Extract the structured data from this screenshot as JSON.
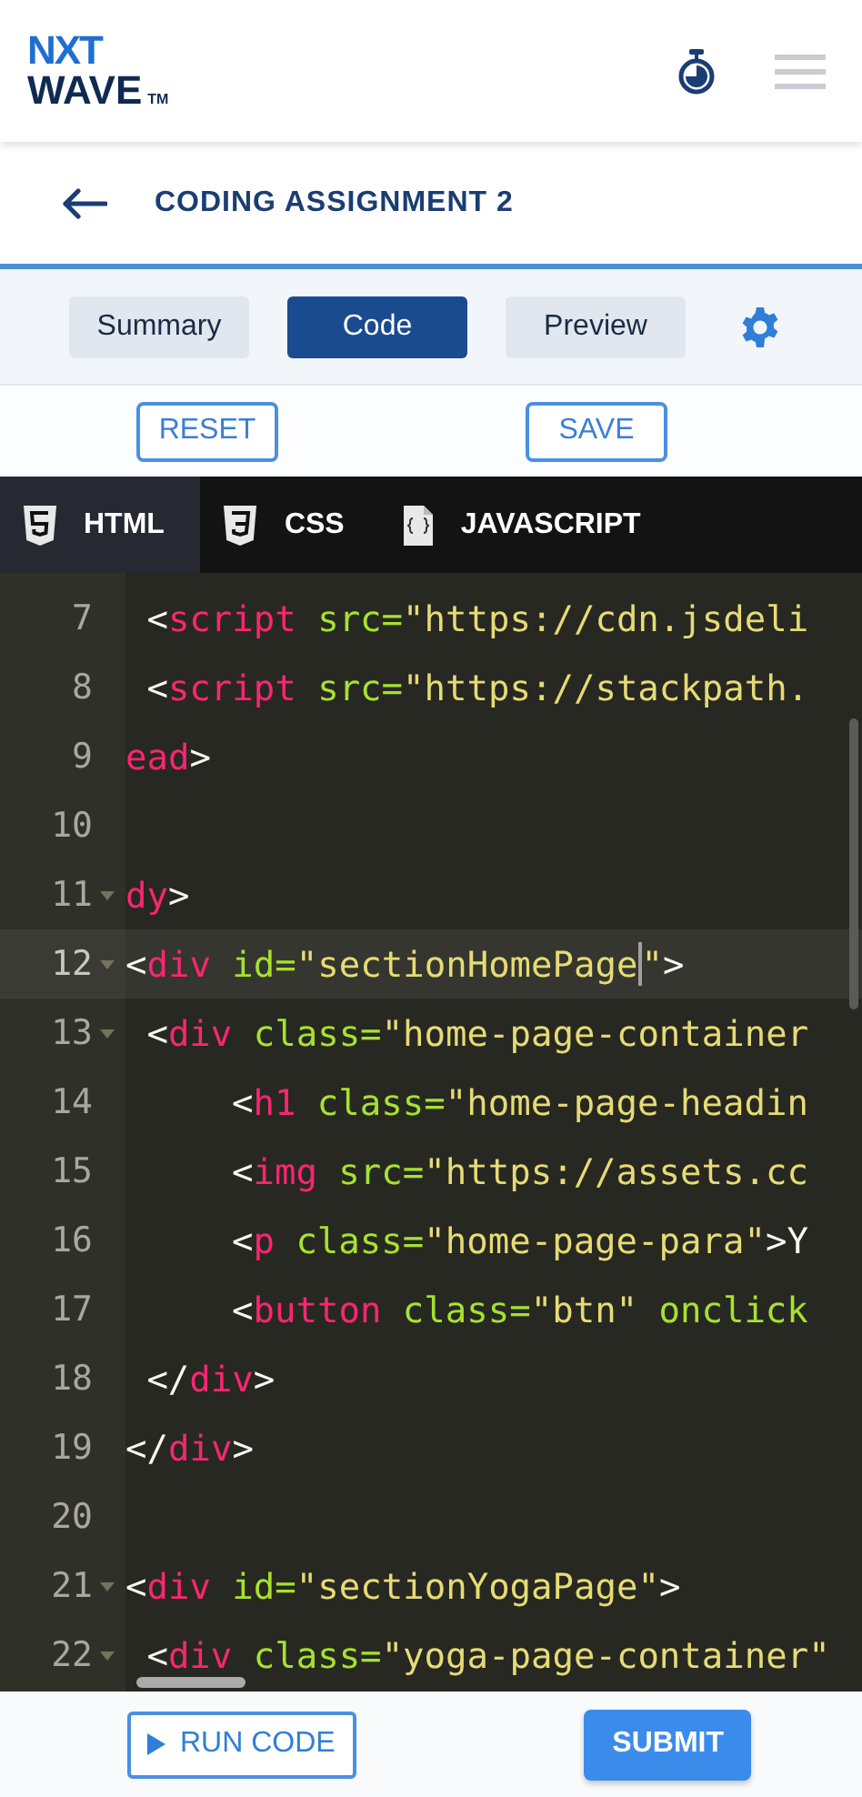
{
  "header": {
    "logo": {
      "top": "NXT",
      "bottom": "WAVE",
      "mark": "TM"
    }
  },
  "title_bar": {
    "title": "CODING ASSIGNMENT 2"
  },
  "view_tabs": [
    {
      "label": "Summary",
      "selected": false
    },
    {
      "label": "Code",
      "selected": true
    },
    {
      "label": "Preview",
      "selected": false
    }
  ],
  "actions": [
    "RESET",
    "SAVE"
  ],
  "language_tabs": [
    {
      "label": "HTML",
      "kind": "html",
      "selected": true
    },
    {
      "label": "CSS",
      "kind": "css",
      "selected": false
    },
    {
      "label": "JAVASCRIPT",
      "kind": "js",
      "selected": false
    }
  ],
  "editor": {
    "lines": [
      {
        "number": "7",
        "kind": "child",
        "active": false,
        "foldable": false,
        "tokens": [
          {
            "kind": "punct",
            "text": "<"
          },
          {
            "kind": "tag",
            "text": "script"
          },
          {
            "kind": "attr",
            "text": "src=",
            "gap": true
          },
          {
            "kind": "str",
            "text": "\"https://cdn.jsdeli"
          }
        ]
      },
      {
        "number": "8",
        "kind": "child",
        "active": false,
        "foldable": false,
        "tokens": [
          {
            "kind": "punct",
            "text": "<"
          },
          {
            "kind": "tag",
            "text": "script"
          },
          {
            "kind": "attr",
            "text": "src=",
            "gap": true
          },
          {
            "kind": "str",
            "text": "\"https://stackpath."
          }
        ]
      },
      {
        "number": "9",
        "kind": "root",
        "active": false,
        "foldable": false,
        "tokens": [
          {
            "kind": "tag",
            "text": "ead"
          },
          {
            "kind": "punct",
            "text": ">"
          }
        ]
      },
      {
        "number": "10",
        "kind": "root",
        "active": false,
        "foldable": false
      },
      {
        "number": "11",
        "kind": "root",
        "active": false,
        "foldable": true,
        "tokens": [
          {
            "kind": "tag",
            "text": "dy"
          },
          {
            "kind": "punct",
            "text": ">"
          }
        ]
      },
      {
        "number": "12",
        "kind": "root",
        "active": true,
        "foldable": true,
        "tokens": [
          {
            "kind": "punct",
            "text": "<"
          },
          {
            "kind": "tag",
            "text": "div"
          },
          {
            "kind": "attr",
            "text": "id=",
            "gap": true
          },
          {
            "kind": "str",
            "text": "\"sectionHomePage"
          },
          {
            "kind": "cursor"
          },
          {
            "kind": "str",
            "text": "\""
          },
          {
            "kind": "punct",
            "text": ">"
          }
        ]
      },
      {
        "number": "13",
        "kind": "child",
        "active": false,
        "foldable": true,
        "tokens": [
          {
            "kind": "punct",
            "text": "<"
          },
          {
            "kind": "tag",
            "text": "div"
          },
          {
            "kind": "attr",
            "text": "class=",
            "gap": true
          },
          {
            "kind": "str",
            "text": "\"home-page-container"
          }
        ]
      },
      {
        "number": "14",
        "kind": "nested",
        "active": false,
        "foldable": false,
        "tokens": [
          {
            "kind": "punct",
            "text": "<"
          },
          {
            "kind": "tag",
            "text": "h1"
          },
          {
            "kind": "attr",
            "text": "class=",
            "gap": true
          },
          {
            "kind": "str",
            "text": "\"home-page-headin"
          }
        ]
      },
      {
        "number": "15",
        "kind": "nested",
        "active": false,
        "foldable": false,
        "tokens": [
          {
            "kind": "punct",
            "text": "<"
          },
          {
            "kind": "tag",
            "text": "img"
          },
          {
            "kind": "attr",
            "text": "src=",
            "gap": true
          },
          {
            "kind": "str",
            "text": "\"https://assets.cc"
          }
        ]
      },
      {
        "number": "16",
        "kind": "nested",
        "active": false,
        "foldable": false,
        "tokens": [
          {
            "kind": "punct",
            "text": "<"
          },
          {
            "kind": "tag",
            "text": "p"
          },
          {
            "kind": "attr",
            "text": "class=",
            "gap": true
          },
          {
            "kind": "str",
            "text": "\"home-page-para\""
          },
          {
            "kind": "punct",
            "text": ">Y"
          }
        ]
      },
      {
        "number": "17",
        "kind": "nested",
        "active": false,
        "foldable": false,
        "tokens": [
          {
            "kind": "punct",
            "text": "<"
          },
          {
            "kind": "tag",
            "text": "button"
          },
          {
            "kind": "attr",
            "text": "class=",
            "gap": true
          },
          {
            "kind": "str",
            "text": "\"btn\""
          },
          {
            "kind": "attr",
            "text": "onclick",
            "gap": true
          }
        ]
      },
      {
        "number": "18",
        "kind": "child",
        "active": false,
        "foldable": false,
        "tokens": [
          {
            "kind": "punct",
            "text": "</"
          },
          {
            "kind": "tag",
            "text": "div"
          },
          {
            "kind": "punct",
            "text": ">"
          }
        ]
      },
      {
        "number": "19",
        "kind": "root",
        "active": false,
        "foldable": false,
        "tokens": [
          {
            "kind": "punct",
            "text": "</"
          },
          {
            "kind": "tag",
            "text": "div"
          },
          {
            "kind": "punct",
            "text": ">"
          }
        ]
      },
      {
        "number": "20",
        "kind": "root",
        "active": false,
        "foldable": false
      },
      {
        "number": "21",
        "kind": "root",
        "active": false,
        "foldable": true,
        "tokens": [
          {
            "kind": "punct",
            "text": "<"
          },
          {
            "kind": "tag",
            "text": "div"
          },
          {
            "kind": "attr",
            "text": "id=",
            "gap": true
          },
          {
            "kind": "str",
            "text": "\"sectionYogaPage\""
          },
          {
            "kind": "punct",
            "text": ">"
          }
        ]
      },
      {
        "number": "22",
        "kind": "child",
        "active": false,
        "foldable": true,
        "tokens": [
          {
            "kind": "punct",
            "text": "<"
          },
          {
            "kind": "tag",
            "text": "div"
          },
          {
            "kind": "attr",
            "text": "class=",
            "gap": true
          },
          {
            "kind": "str",
            "text": "\"yoga-page-container\""
          }
        ]
      }
    ]
  },
  "bottom_bar": {
    "run": "RUN CODE",
    "submit": "SUBMIT"
  }
}
